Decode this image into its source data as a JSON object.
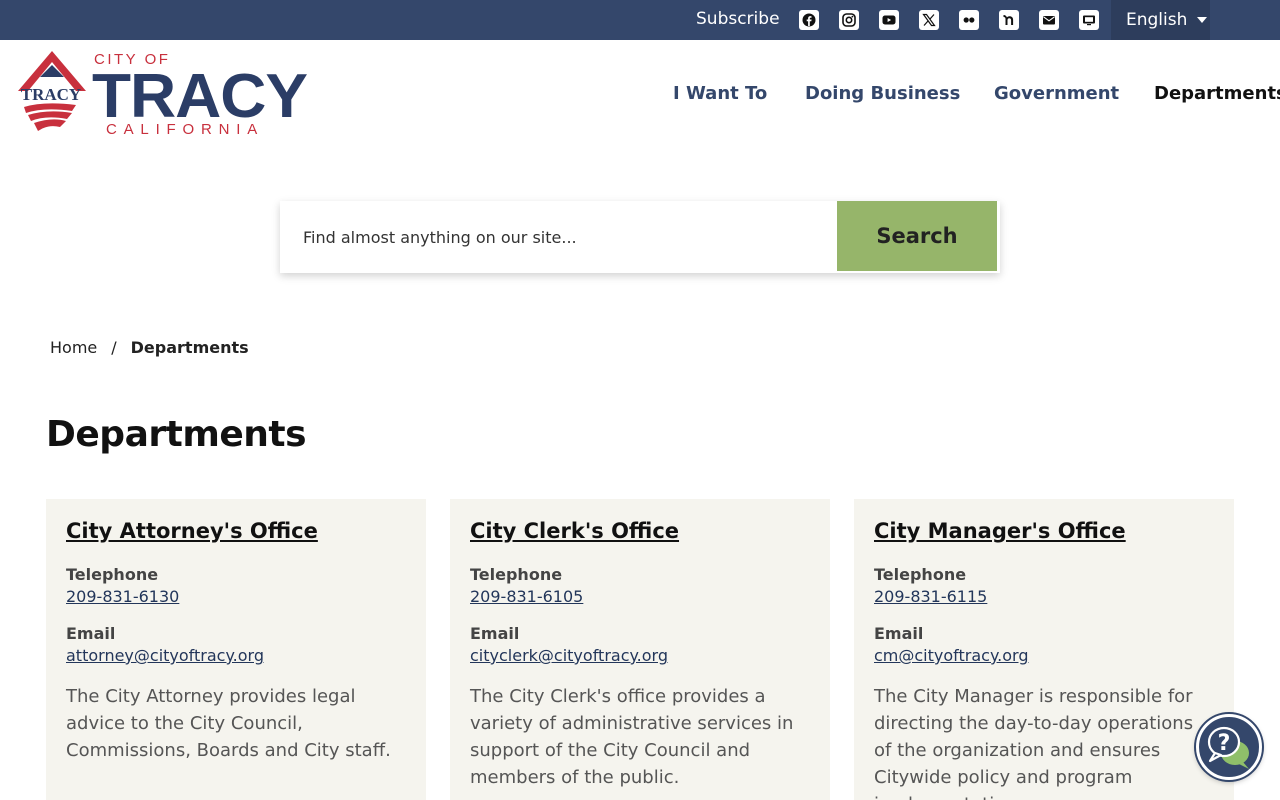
{
  "topbar": {
    "subscribe_label": "Subscribe",
    "social_icons": [
      "facebook-icon",
      "instagram-icon",
      "youtube-icon",
      "x-icon",
      "flickr-icon",
      "nextdoor-icon",
      "email-icon",
      "tv-icon"
    ],
    "language": "English",
    "background": "#34476b"
  },
  "logo": {
    "city_of": "CITY OF",
    "name": "TRACY",
    "state": "CALIFORNIA",
    "badge": "TRACY"
  },
  "nav": {
    "items": [
      {
        "label": "I Want To"
      },
      {
        "label": "Doing Business"
      },
      {
        "label": "Government"
      },
      {
        "label": "Departments"
      }
    ]
  },
  "search": {
    "placeholder": "Find almost anything on our site...",
    "button_label": "Search",
    "button_color": "#96b56a"
  },
  "breadcrumb": {
    "home": "Home",
    "separator": "/",
    "current": "Departments"
  },
  "page_title": "Departments",
  "cards": [
    {
      "title": "City Attorney's Office",
      "telephone_label": "Telephone",
      "telephone": "209-831-6130",
      "email_label": "Email",
      "email": "attorney@cityoftracy.org",
      "description": "The City Attorney provides legal advice to the City Council, Commissions, Boards and City staff."
    },
    {
      "title": "City Clerk's Office",
      "telephone_label": "Telephone",
      "telephone": "209-831-6105",
      "email_label": "Email",
      "email": "cityclerk@cityoftracy.org",
      "description": "The City Clerk's office provides a variety of administrative services in support of the City Council and members of the public."
    },
    {
      "title": "City Manager's Office",
      "telephone_label": "Telephone",
      "telephone": "209-831-6115",
      "email_label": "Email",
      "email": "cm@cityoftracy.org",
      "description": "The City Manager is responsible for directing the day-to-day operations of the organization and ensures Citywide policy and program implementation."
    }
  ],
  "help_widget": {
    "icon": "help-chat-icon",
    "glyph": "?"
  }
}
